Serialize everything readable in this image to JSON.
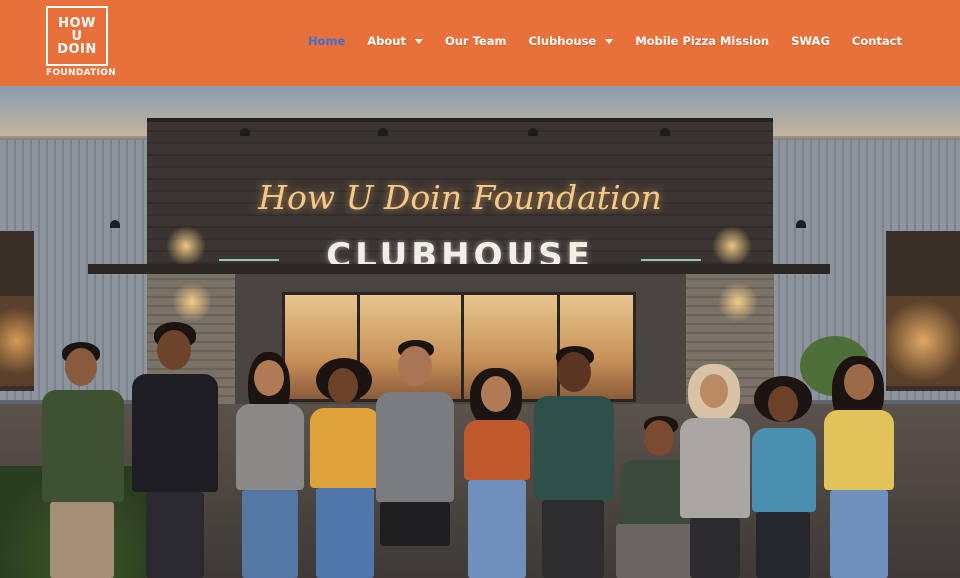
{
  "logo": {
    "line1": "HOW",
    "line2": "U",
    "line3": "DOIN",
    "sub": "FOUNDATION"
  },
  "nav": {
    "items": [
      {
        "label": "Home",
        "active": true,
        "dropdown": false
      },
      {
        "label": "About",
        "active": false,
        "dropdown": true
      },
      {
        "label": "Our Team",
        "active": false,
        "dropdown": false
      },
      {
        "label": "Clubhouse",
        "active": false,
        "dropdown": true
      },
      {
        "label": "Mobile Pizza Mission",
        "active": false,
        "dropdown": false
      },
      {
        "label": "SWAG",
        "active": false,
        "dropdown": false
      },
      {
        "label": "Contact",
        "active": false,
        "dropdown": false
      }
    ]
  },
  "hero": {
    "sign_script": "How U Doin Foundation",
    "sign_block": "CLUBHOUSE"
  },
  "colors": {
    "header_bg": "#e8703a",
    "nav_active": "#3b6fd6",
    "nav_text": "#ffffff"
  }
}
